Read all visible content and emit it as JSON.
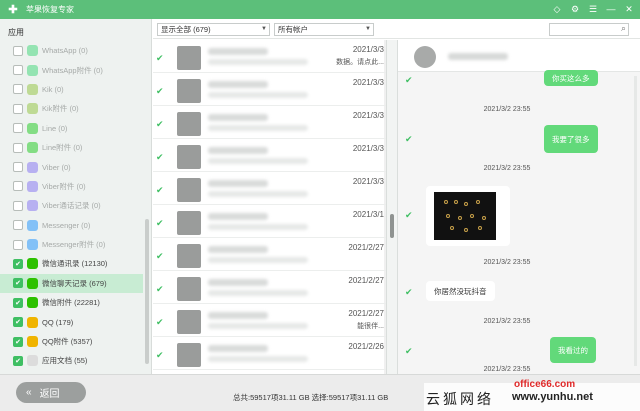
{
  "titlebar": {
    "title": "苹果恢复专家",
    "controls": [
      "diamond-icon",
      "settings-icon",
      "menu-icon",
      "minimize-icon",
      "close-icon"
    ]
  },
  "sidebar": {
    "section_title": "应用",
    "items": [
      {
        "label": "WhatsApp (0)",
        "checked": false,
        "dim": true,
        "active": false,
        "icon": "whatsapp-icon",
        "color": "#25d366"
      },
      {
        "label": "WhatsApp附件 (0)",
        "checked": false,
        "dim": true,
        "active": false,
        "icon": "whatsapp-attachment-icon",
        "color": "#25d366"
      },
      {
        "label": "Kik (0)",
        "checked": false,
        "dim": true,
        "active": false,
        "icon": "kik-icon",
        "color": "#82bc23"
      },
      {
        "label": "Kik附件 (0)",
        "checked": false,
        "dim": true,
        "active": false,
        "icon": "kik-attachment-icon",
        "color": "#82bc23"
      },
      {
        "label": "Line (0)",
        "checked": false,
        "dim": true,
        "active": false,
        "icon": "line-icon",
        "color": "#00c300"
      },
      {
        "label": "Line附件 (0)",
        "checked": false,
        "dim": true,
        "active": false,
        "icon": "line-attachment-icon",
        "color": "#00c300"
      },
      {
        "label": "Viber (0)",
        "checked": false,
        "dim": true,
        "active": false,
        "icon": "viber-icon",
        "color": "#7360f2"
      },
      {
        "label": "Viber附件 (0)",
        "checked": false,
        "dim": true,
        "active": false,
        "icon": "viber-attachment-icon",
        "color": "#7360f2"
      },
      {
        "label": "Viber通话记录 (0)",
        "checked": false,
        "dim": true,
        "active": false,
        "icon": "viber-call-icon",
        "color": "#7360f2"
      },
      {
        "label": "Messenger (0)",
        "checked": false,
        "dim": true,
        "active": false,
        "icon": "messenger-icon",
        "color": "#0084ff"
      },
      {
        "label": "Messenger附件 (0)",
        "checked": false,
        "dim": true,
        "active": false,
        "icon": "messenger-attachment-icon",
        "color": "#0084ff"
      },
      {
        "label": "微信通讯录 (12130)",
        "checked": true,
        "dim": false,
        "active": false,
        "icon": "wechat-contacts-icon",
        "color": "#2dc100"
      },
      {
        "label": "微信聊天记录 (679)",
        "checked": true,
        "dim": false,
        "active": true,
        "icon": "wechat-icon",
        "color": "#2dc100"
      },
      {
        "label": "微信附件 (22281)",
        "checked": true,
        "dim": false,
        "active": false,
        "icon": "wechat-attachment-icon",
        "color": "#2dc100"
      },
      {
        "label": "QQ (179)",
        "checked": true,
        "dim": false,
        "active": false,
        "icon": "qq-icon",
        "color": "#f0b400"
      },
      {
        "label": "QQ附件 (5357)",
        "checked": true,
        "dim": false,
        "active": false,
        "icon": "qq-attachment-icon",
        "color": "#f0b400"
      },
      {
        "label": "应用文档 (55)",
        "checked": true,
        "dim": false,
        "active": false,
        "icon": "app-document-icon",
        "color": "#dcdcdc"
      }
    ]
  },
  "filters": {
    "display": "显示全部 (679)",
    "account": "所有帐户",
    "search_placeholder": ""
  },
  "list": {
    "rows": [
      {
        "date": "2021/3/3",
        "preview": "数据。请点此..."
      },
      {
        "date": "2021/3/3",
        "preview": ""
      },
      {
        "date": "2021/3/3",
        "preview": ""
      },
      {
        "date": "2021/3/3",
        "preview": ""
      },
      {
        "date": "2021/3/3",
        "preview": ""
      },
      {
        "date": "2021/3/1",
        "preview": ""
      },
      {
        "date": "2021/2/27",
        "preview": ""
      },
      {
        "date": "2021/2/27",
        "preview": ""
      },
      {
        "date": "2021/2/27",
        "preview": "能很伴..."
      },
      {
        "date": "2021/2/26",
        "preview": ""
      }
    ]
  },
  "chat": {
    "messages": [
      {
        "text": "你买这么多",
        "side": "out"
      },
      {
        "text": "我要了很多",
        "side": "out"
      },
      {
        "text": "你居然没玩抖音",
        "side": "in"
      },
      {
        "text": "我看过的",
        "side": "out"
      }
    ],
    "timestamps": [
      "2021/3/2 23:55",
      "2021/3/2 23:55",
      "2021/3/2 23:55",
      "2021/3/2 23:55",
      "2021/3/2 23:55"
    ]
  },
  "footer": {
    "back_label": "返回",
    "summary": "总共:59517项31.11 GB 选择:59517项31.11 GB",
    "watermark_cn": "云狐网络",
    "watermark_url": "www.yunhu.net",
    "watermark_brand": "office66.com"
  }
}
